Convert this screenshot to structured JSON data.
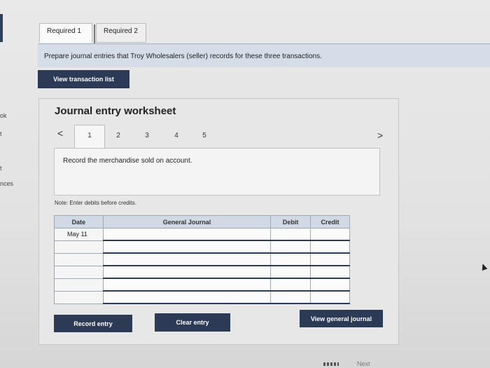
{
  "sidebar_fragments": [
    "ok",
    "t",
    "t",
    "nces"
  ],
  "tabs": [
    {
      "label": "Required 1",
      "active": true
    },
    {
      "label": "Required 2",
      "active": false
    }
  ],
  "instructions": "Prepare journal entries that Troy Wholesalers (seller) records for these three transactions.",
  "view_transaction_list_label": "View transaction list",
  "worksheet": {
    "title": "Journal entry worksheet",
    "prev_icon": "<",
    "next_icon": ">",
    "entry_numbers": [
      "1",
      "2",
      "3",
      "4",
      "5"
    ],
    "active_entry": "1",
    "record_text": "Record the merchandise sold on account.",
    "note": "Note: Enter debits before credits.",
    "table": {
      "headers": [
        "Date",
        "General Journal",
        "Debit",
        "Credit"
      ],
      "rows": [
        {
          "date": "May 11",
          "account": "",
          "debit": "",
          "credit": ""
        },
        {
          "date": "",
          "account": "",
          "debit": "",
          "credit": ""
        },
        {
          "date": "",
          "account": "",
          "debit": "",
          "credit": ""
        },
        {
          "date": "",
          "account": "",
          "debit": "",
          "credit": ""
        },
        {
          "date": "",
          "account": "",
          "debit": "",
          "credit": ""
        },
        {
          "date": "",
          "account": "",
          "debit": "",
          "credit": ""
        }
      ]
    },
    "buttons": {
      "record": "Record entry",
      "clear": "Clear entry",
      "view_journal": "View general journal"
    }
  },
  "footer_next": "Next"
}
